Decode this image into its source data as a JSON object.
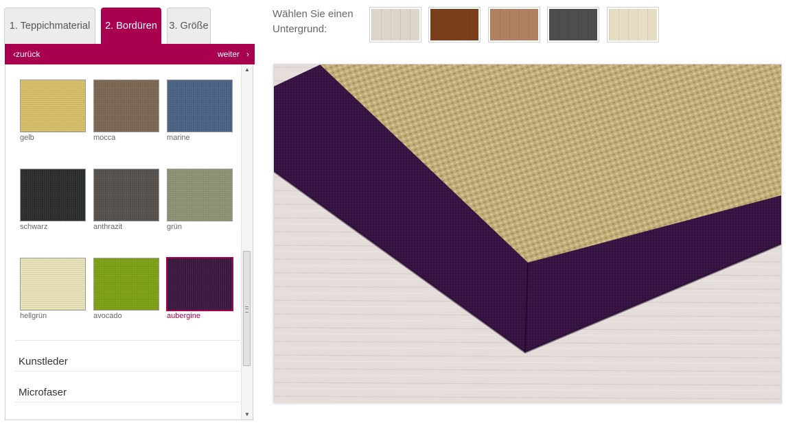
{
  "tabs": [
    {
      "label": "1. Teppichmaterial"
    },
    {
      "label": "2. Bordüren"
    },
    {
      "label": "3. Größe"
    }
  ],
  "nav": {
    "back_label": "zurück",
    "next_label": "weiter"
  },
  "swatches": [
    {
      "label": "gelb",
      "color": "#d8c06b"
    },
    {
      "label": "mocca",
      "color": "#7c6852"
    },
    {
      "label": "marine",
      "color": "#4b6386"
    },
    {
      "label": "schwarz",
      "color": "#2b2e2c"
    },
    {
      "label": "anthrazit",
      "color": "#57514d"
    },
    {
      "label": "grün",
      "color": "#8f9374"
    },
    {
      "label": "hellgrün",
      "color": "#e9e4b8"
    },
    {
      "label": "avocado",
      "color": "#7fa214"
    },
    {
      "label": "aubergine",
      "color": "#3b1840",
      "selected": true
    }
  ],
  "categories": [
    {
      "label": "Kunstleder"
    },
    {
      "label": "Microfaser"
    }
  ],
  "background": {
    "label": "Wählen Sie einen Untergrund:",
    "options": [
      {
        "name": "light-wood-floor",
        "color": "#ddd4cc"
      },
      {
        "name": "dark-wood-floor",
        "color": "#7a3f1a"
      },
      {
        "name": "pine-wood-floor",
        "color": "#b08060"
      },
      {
        "name": "dark-tile-floor",
        "color": "#4e4e4e"
      },
      {
        "name": "beige-tile-floor",
        "color": "#e6ddc2"
      }
    ]
  },
  "preview": {
    "border_color": "#3a1646",
    "carpet_color": "#c2ac78",
    "floor_color": "#e4ddda"
  },
  "colors": {
    "accent": "#a8004f"
  }
}
